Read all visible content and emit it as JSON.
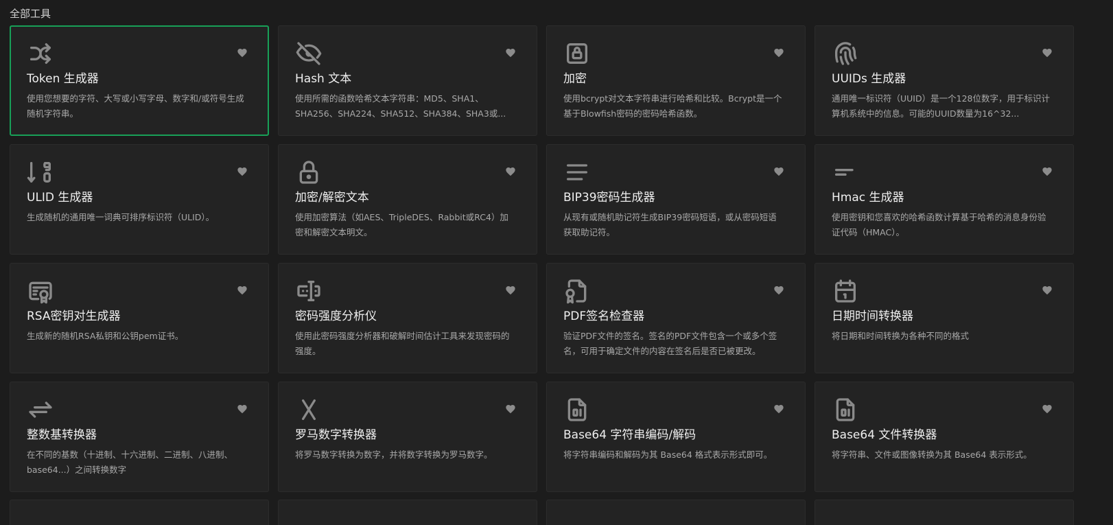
{
  "section": {
    "title": "全部工具"
  },
  "cards": [
    {
      "icon": "shuffle-icon",
      "title": "Token 生成器",
      "desc": "使用您想要的字符、大写或小写字母、数字和/或符号生成随机字符串。"
    },
    {
      "icon": "eye-off-icon",
      "title": "Hash 文本",
      "desc": "使用所需的函数哈希文本字符串：MD5、SHA1、SHA256、SHA224、SHA512、SHA384、SHA3或..."
    },
    {
      "icon": "lock-square-icon",
      "title": "加密",
      "desc": "使用bcrypt对文本字符串进行哈希和比较。Bcrypt是一个基于Blowfish密码的密码哈希函数。"
    },
    {
      "icon": "fingerprint-icon",
      "title": "UUIDs 生成器",
      "desc": "通用唯一标识符（UUID）是一个128位数字，用于标识计算机系统中的信息。可能的UUID数量为16^32..."
    },
    {
      "icon": "sort-numeric-icon",
      "title": "ULID 生成器",
      "desc": "生成随机的通用唯一词典可排序标识符（ULID）。"
    },
    {
      "icon": "lock-icon",
      "title": "加密/解密文本",
      "desc": "使用加密算法（如AES、TripleDES、Rabbit或RC4）加密和解密文本明文。"
    },
    {
      "icon": "list-lines-icon",
      "title": "BIP39密码生成器",
      "desc": "从现有或随机助记符生成BIP39密码短语，或从密码短语获取助记符。"
    },
    {
      "icon": "short-text-icon",
      "title": "Hmac 生成器",
      "desc": "使用密钥和您喜欢的哈希函数计算基于哈希的消息身份验证代码（HMAC）。"
    },
    {
      "icon": "certificate-icon",
      "title": "RSA密钥对生成器",
      "desc": "生成新的随机RSA私钥和公钥pem证书。"
    },
    {
      "icon": "password-input-icon",
      "title": "密码强度分析仪",
      "desc": "使用此密码强度分析器和破解时间估计工具来发现密码的强度。"
    },
    {
      "icon": "file-certificate-icon",
      "title": "PDF签名检查器",
      "desc": "验证PDF文件的签名。签名的PDF文件包含一个或多个签名，可用于确定文件的内容在签名后是否已被更改。"
    },
    {
      "icon": "calendar-icon",
      "title": "日期时间转换器",
      "desc": "将日期和时间转换为各种不同的格式"
    },
    {
      "icon": "arrows-exchange-icon",
      "title": "整数基转换器",
      "desc": "在不同的基数（十进制、十六进制、二进制、八进制、base64...）之间转换数字"
    },
    {
      "icon": "letter-x-icon",
      "title": "罗马数字转换器",
      "desc": "将罗马数字转换为数字，并将数字转换为罗马数字。"
    },
    {
      "icon": "file-binary-icon",
      "title": "Base64 字符串编码/解码",
      "desc": "将字符串编码和解码为其 Base64 格式表示形式即可。"
    },
    {
      "icon": "file-binary-icon",
      "title": "Base64 文件转换器",
      "desc": "将字符串、文件或图像转换为其 Base64 表示形式。"
    }
  ],
  "colors": {
    "background": "#1c1c1c",
    "card": "#232323",
    "active_border": "#18a058",
    "icon": "#8a8a8a"
  }
}
